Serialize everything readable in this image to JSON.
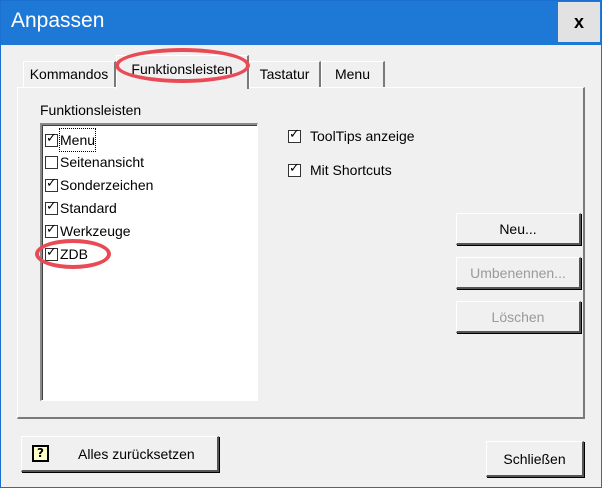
{
  "window": {
    "title": "Anpassen",
    "close_label": "x"
  },
  "tabs": [
    {
      "label": "Kommandos"
    },
    {
      "label": "Funktionsleisten",
      "active": true
    },
    {
      "label": "Tastatur"
    },
    {
      "label": "Menu"
    }
  ],
  "toolbars_group": {
    "label": "Funktionsleisten",
    "items": [
      {
        "label": "Menu",
        "checked": true,
        "focused": true
      },
      {
        "label": "Seitenansicht",
        "checked": false
      },
      {
        "label": "Sonderzeichen",
        "checked": true
      },
      {
        "label": "Standard",
        "checked": true
      },
      {
        "label": "Werkzeuge",
        "checked": true
      },
      {
        "label": "ZDB",
        "checked": true
      }
    ]
  },
  "options": {
    "tooltips_label": "ToolTips anzeige",
    "tooltips_checked": true,
    "shortcuts_label": "Mit Shortcuts",
    "shortcuts_checked": true
  },
  "buttons": {
    "new": "Neu...",
    "rename": "Umbenennen...",
    "delete": "Löschen",
    "reset_all": "Alles zurücksetzen",
    "help_icon_glyph": "?",
    "close": "Schließen"
  },
  "colors": {
    "titlebar": "#1e78d6",
    "highlight": "#e84b55"
  },
  "icons": {
    "help": "help-icon",
    "close": "close-icon",
    "checkbox": "checkbox-icon"
  }
}
